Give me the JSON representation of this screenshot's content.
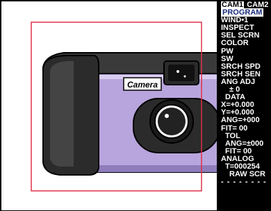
{
  "camera_tabs": [
    {
      "label": "CAM1",
      "active": true
    },
    {
      "label": "CAM2",
      "active": false
    }
  ],
  "menu": {
    "program": "PROGRAM",
    "wind": "WIND•1",
    "inspect": "INSPECT",
    "sel_scrn": "SEL SCRN",
    "color": "COLOR",
    "pw": "PW",
    "sw": "SW",
    "srch_spd": "SRCH SPD",
    "srch_sen": "SRCH SEN",
    "ang_adj": "ANG ADJ",
    "ang_adj_value": "± 0",
    "data_header": "DATA",
    "x": "X=+0.000",
    "y": "Y=+0.000",
    "ang": "ANG=+000",
    "fit": "FIT= 00",
    "tol_header": "TOL",
    "tol_ang": "ANG=±000",
    "tol_fit": "FIT= 00",
    "analog": "ANALOG",
    "t": "T=000254",
    "raw_scr": "RAW SCR",
    "dashes": "- - - - - - - -"
  },
  "image": {
    "brand_label": "Camera"
  },
  "colors": {
    "menu_background": "#000000",
    "menu_text": "#ffffff",
    "selected_text": "#1a2b7a",
    "camera_body": "#b9a5dd",
    "camera_grip": "#2b2b2b",
    "inspection_window": "#e0304a"
  }
}
